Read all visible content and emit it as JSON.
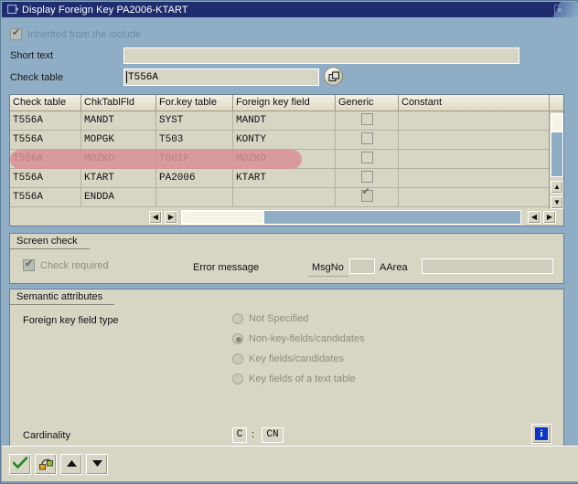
{
  "window": {
    "title": "Display Foreign Key PA2006-KTART",
    "title_icon": "dialog-window-icon",
    "close_label": "×"
  },
  "header": {
    "inherited_label": "Inherited from the include",
    "inherited_checked": true,
    "short_text_label": "Short text",
    "short_text_value": "",
    "check_table_label": "Check table",
    "check_table_value": "T556A",
    "check_table_help_icon": "search-help-icon"
  },
  "grid": {
    "columns": [
      "Check table",
      "ChkTablFld",
      "For.key table",
      "Foreign key field",
      "Generic",
      "Constant"
    ],
    "rows": [
      {
        "check_table": "T556A",
        "chk_tabl_fld": "MANDT",
        "for_key_table": "SYST",
        "foreign_key_field": "MANDT",
        "generic": false,
        "constant": "",
        "selected": false
      },
      {
        "check_table": "T556A",
        "chk_tabl_fld": "MOPGK",
        "for_key_table": "T503",
        "foreign_key_field": "KONTY",
        "generic": false,
        "constant": "",
        "selected": false
      },
      {
        "check_table": "T556A",
        "chk_tabl_fld": "MOZKO",
        "for_key_table": "T001P",
        "foreign_key_field": "MOZKO",
        "generic": false,
        "constant": "",
        "selected": true
      },
      {
        "check_table": "T556A",
        "chk_tabl_fld": "KTART",
        "for_key_table": "PA2006",
        "foreign_key_field": "KTART",
        "generic": false,
        "constant": "",
        "selected": false
      },
      {
        "check_table": "T556A",
        "chk_tabl_fld": "ENDDA",
        "for_key_table": "",
        "foreign_key_field": "",
        "generic": true,
        "constant": "",
        "selected": false
      }
    ],
    "selection_color": "#d98f96",
    "scroll_up_icon": "▲",
    "scroll_down_icon": "▼",
    "scroll_left_icon": "◀",
    "scroll_right_icon": "▶"
  },
  "screen_check": {
    "group_title": "Screen check",
    "check_required_label": "Check required",
    "check_required_checked": true,
    "error_message_label": "Error message",
    "msgno_label": "MsgNo",
    "msgno_value": "",
    "aarea_label": "AArea",
    "aarea_value": ""
  },
  "semantic_attributes": {
    "group_title": "Semantic attributes",
    "fk_field_type_label": "Foreign key field type",
    "options": [
      {
        "label": "Not Specified",
        "selected": false
      },
      {
        "label": "Non-key-fields/candidates",
        "selected": true
      },
      {
        "label": "Key fields/candidates",
        "selected": false
      },
      {
        "label": "Key fields of a text table",
        "selected": false
      }
    ],
    "cardinality_label": "Cardinality",
    "cardinality_left": "C",
    "cardinality_separator": ":",
    "cardinality_right": "CN",
    "info_icon": "information-icon",
    "info_glyph": "i"
  },
  "toolbar": {
    "buttons": [
      {
        "name": "continue-button",
        "icon": "green-check-icon"
      },
      {
        "name": "where-used-button",
        "icon": "where-used-list-icon"
      },
      {
        "name": "previous-button",
        "icon": "up-arrow-icon"
      },
      {
        "name": "next-button",
        "icon": "down-arrow-icon"
      }
    ]
  }
}
